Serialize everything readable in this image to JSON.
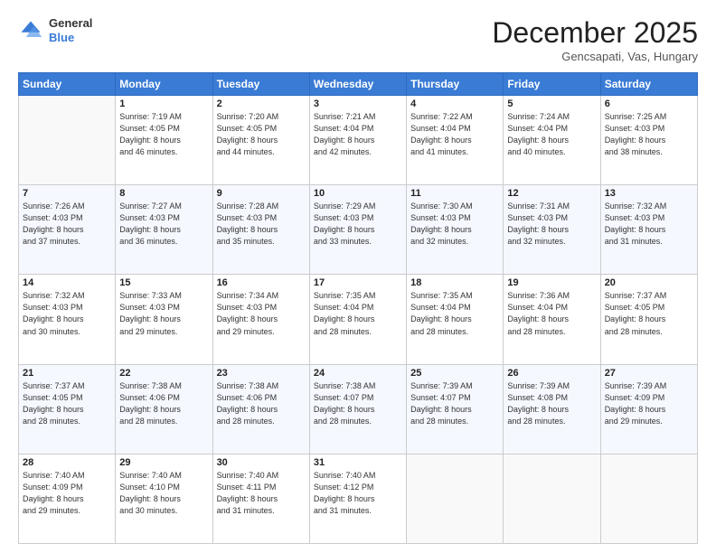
{
  "header": {
    "logo": {
      "general": "General",
      "blue": "Blue"
    },
    "title": "December 2025",
    "subtitle": "Gencsapati, Vas, Hungary"
  },
  "days_of_week": [
    "Sunday",
    "Monday",
    "Tuesday",
    "Wednesday",
    "Thursday",
    "Friday",
    "Saturday"
  ],
  "weeks": [
    [
      {
        "num": "",
        "info": ""
      },
      {
        "num": "1",
        "info": "Sunrise: 7:19 AM\nSunset: 4:05 PM\nDaylight: 8 hours\nand 46 minutes."
      },
      {
        "num": "2",
        "info": "Sunrise: 7:20 AM\nSunset: 4:05 PM\nDaylight: 8 hours\nand 44 minutes."
      },
      {
        "num": "3",
        "info": "Sunrise: 7:21 AM\nSunset: 4:04 PM\nDaylight: 8 hours\nand 42 minutes."
      },
      {
        "num": "4",
        "info": "Sunrise: 7:22 AM\nSunset: 4:04 PM\nDaylight: 8 hours\nand 41 minutes."
      },
      {
        "num": "5",
        "info": "Sunrise: 7:24 AM\nSunset: 4:04 PM\nDaylight: 8 hours\nand 40 minutes."
      },
      {
        "num": "6",
        "info": "Sunrise: 7:25 AM\nSunset: 4:03 PM\nDaylight: 8 hours\nand 38 minutes."
      }
    ],
    [
      {
        "num": "7",
        "info": "Sunrise: 7:26 AM\nSunset: 4:03 PM\nDaylight: 8 hours\nand 37 minutes."
      },
      {
        "num": "8",
        "info": "Sunrise: 7:27 AM\nSunset: 4:03 PM\nDaylight: 8 hours\nand 36 minutes."
      },
      {
        "num": "9",
        "info": "Sunrise: 7:28 AM\nSunset: 4:03 PM\nDaylight: 8 hours\nand 35 minutes."
      },
      {
        "num": "10",
        "info": "Sunrise: 7:29 AM\nSunset: 4:03 PM\nDaylight: 8 hours\nand 33 minutes."
      },
      {
        "num": "11",
        "info": "Sunrise: 7:30 AM\nSunset: 4:03 PM\nDaylight: 8 hours\nand 32 minutes."
      },
      {
        "num": "12",
        "info": "Sunrise: 7:31 AM\nSunset: 4:03 PM\nDaylight: 8 hours\nand 32 minutes."
      },
      {
        "num": "13",
        "info": "Sunrise: 7:32 AM\nSunset: 4:03 PM\nDaylight: 8 hours\nand 31 minutes."
      }
    ],
    [
      {
        "num": "14",
        "info": "Sunrise: 7:32 AM\nSunset: 4:03 PM\nDaylight: 8 hours\nand 30 minutes."
      },
      {
        "num": "15",
        "info": "Sunrise: 7:33 AM\nSunset: 4:03 PM\nDaylight: 8 hours\nand 29 minutes."
      },
      {
        "num": "16",
        "info": "Sunrise: 7:34 AM\nSunset: 4:03 PM\nDaylight: 8 hours\nand 29 minutes."
      },
      {
        "num": "17",
        "info": "Sunrise: 7:35 AM\nSunset: 4:04 PM\nDaylight: 8 hours\nand 28 minutes."
      },
      {
        "num": "18",
        "info": "Sunrise: 7:35 AM\nSunset: 4:04 PM\nDaylight: 8 hours\nand 28 minutes."
      },
      {
        "num": "19",
        "info": "Sunrise: 7:36 AM\nSunset: 4:04 PM\nDaylight: 8 hours\nand 28 minutes."
      },
      {
        "num": "20",
        "info": "Sunrise: 7:37 AM\nSunset: 4:05 PM\nDaylight: 8 hours\nand 28 minutes."
      }
    ],
    [
      {
        "num": "21",
        "info": "Sunrise: 7:37 AM\nSunset: 4:05 PM\nDaylight: 8 hours\nand 28 minutes."
      },
      {
        "num": "22",
        "info": "Sunrise: 7:38 AM\nSunset: 4:06 PM\nDaylight: 8 hours\nand 28 minutes."
      },
      {
        "num": "23",
        "info": "Sunrise: 7:38 AM\nSunset: 4:06 PM\nDaylight: 8 hours\nand 28 minutes."
      },
      {
        "num": "24",
        "info": "Sunrise: 7:38 AM\nSunset: 4:07 PM\nDaylight: 8 hours\nand 28 minutes."
      },
      {
        "num": "25",
        "info": "Sunrise: 7:39 AM\nSunset: 4:07 PM\nDaylight: 8 hours\nand 28 minutes."
      },
      {
        "num": "26",
        "info": "Sunrise: 7:39 AM\nSunset: 4:08 PM\nDaylight: 8 hours\nand 28 minutes."
      },
      {
        "num": "27",
        "info": "Sunrise: 7:39 AM\nSunset: 4:09 PM\nDaylight: 8 hours\nand 29 minutes."
      }
    ],
    [
      {
        "num": "28",
        "info": "Sunrise: 7:40 AM\nSunset: 4:09 PM\nDaylight: 8 hours\nand 29 minutes."
      },
      {
        "num": "29",
        "info": "Sunrise: 7:40 AM\nSunset: 4:10 PM\nDaylight: 8 hours\nand 30 minutes."
      },
      {
        "num": "30",
        "info": "Sunrise: 7:40 AM\nSunset: 4:11 PM\nDaylight: 8 hours\nand 31 minutes."
      },
      {
        "num": "31",
        "info": "Sunrise: 7:40 AM\nSunset: 4:12 PM\nDaylight: 8 hours\nand 31 minutes."
      },
      {
        "num": "",
        "info": ""
      },
      {
        "num": "",
        "info": ""
      },
      {
        "num": "",
        "info": ""
      }
    ]
  ]
}
